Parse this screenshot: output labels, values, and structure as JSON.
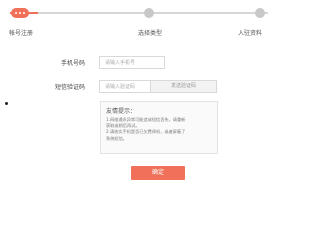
{
  "steps": {
    "step1": "帐号注册",
    "step2": "选择类型",
    "step3": "入驻资料",
    "active_color": "#f0705a",
    "inactive_color": "#d6d6d6"
  },
  "form": {
    "phone_label": "手机号码",
    "phone_placeholder": "请输入手机号",
    "code_label": "短信验证码",
    "code_placeholder": "请输入验证码",
    "send_code_label": "发送验证码"
  },
  "tips": {
    "title": "友情提示：",
    "line1": "1.网络通讯异常可能造成短信丢失，请重新",
    "line2": "获取或稍后再试。",
    "line3": "2.请核实手机是否已欠费停机，或者屏蔽了",
    "line4": "系统短信。"
  },
  "confirm_label": "确定",
  "accent_color": "#f0705a"
}
